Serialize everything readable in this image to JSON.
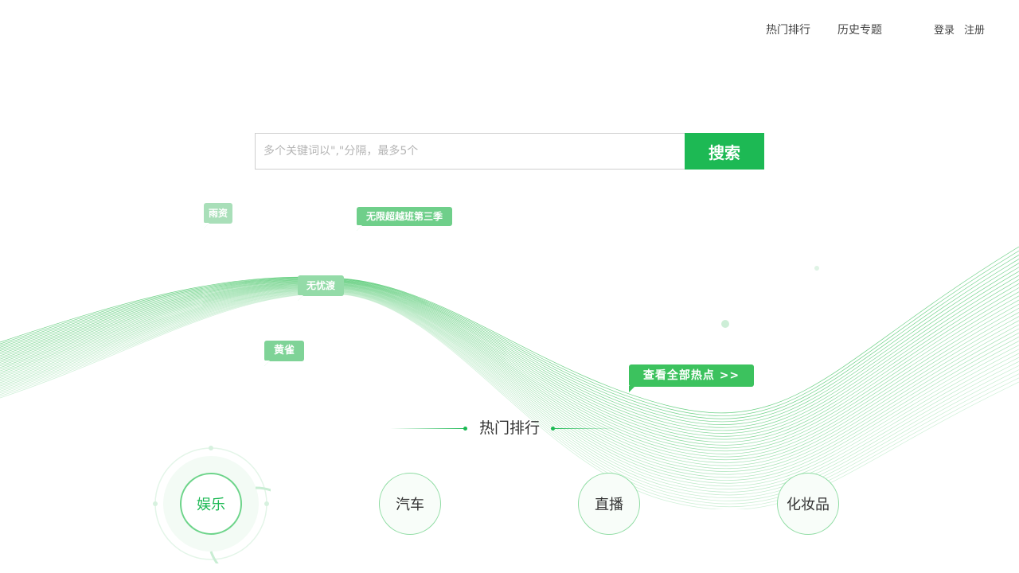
{
  "nav": {
    "hot_rank": "热门排行",
    "history": "历史专题",
    "login": "登录",
    "register": "注册"
  },
  "search": {
    "placeholder": "多个关键词以\",\"分隔，最多5个",
    "value": "",
    "button_label": "搜索"
  },
  "hot_tags": [
    {
      "label": "雨资",
      "color": "#a9dfb9"
    },
    {
      "label": "无限超越班第三季",
      "color": "#6fcf8a"
    },
    {
      "label": "无忧渡",
      "color": "#94dba8"
    },
    {
      "label": "黄雀",
      "color": "#7fd397"
    }
  ],
  "view_all": {
    "label": "查看全部热点 >>",
    "color": "#3cc25e"
  },
  "section": {
    "title": "热门排行"
  },
  "categories": [
    {
      "label": "娱乐",
      "active": true
    },
    {
      "label": "汽车",
      "active": false
    },
    {
      "label": "直播",
      "active": false
    },
    {
      "label": "化妆品",
      "active": false
    }
  ],
  "colors": {
    "accent": "#1db954",
    "wave": "#3cc25e"
  }
}
